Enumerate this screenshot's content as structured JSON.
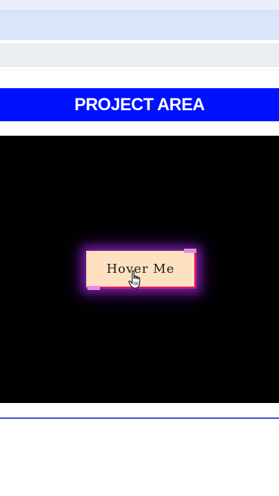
{
  "header": {
    "title": "PROJECT AREA"
  },
  "stage": {
    "button_label": "Hover Me"
  },
  "colors": {
    "header_bg": "#0011ff",
    "stage_bg": "#000000",
    "button_bg": "#fde1c1",
    "button_border": "#e01a6a",
    "corner_accent": "#e48ce4",
    "glow": "#be3cff"
  },
  "icons": {
    "cursor": "hand-pointer-icon"
  }
}
